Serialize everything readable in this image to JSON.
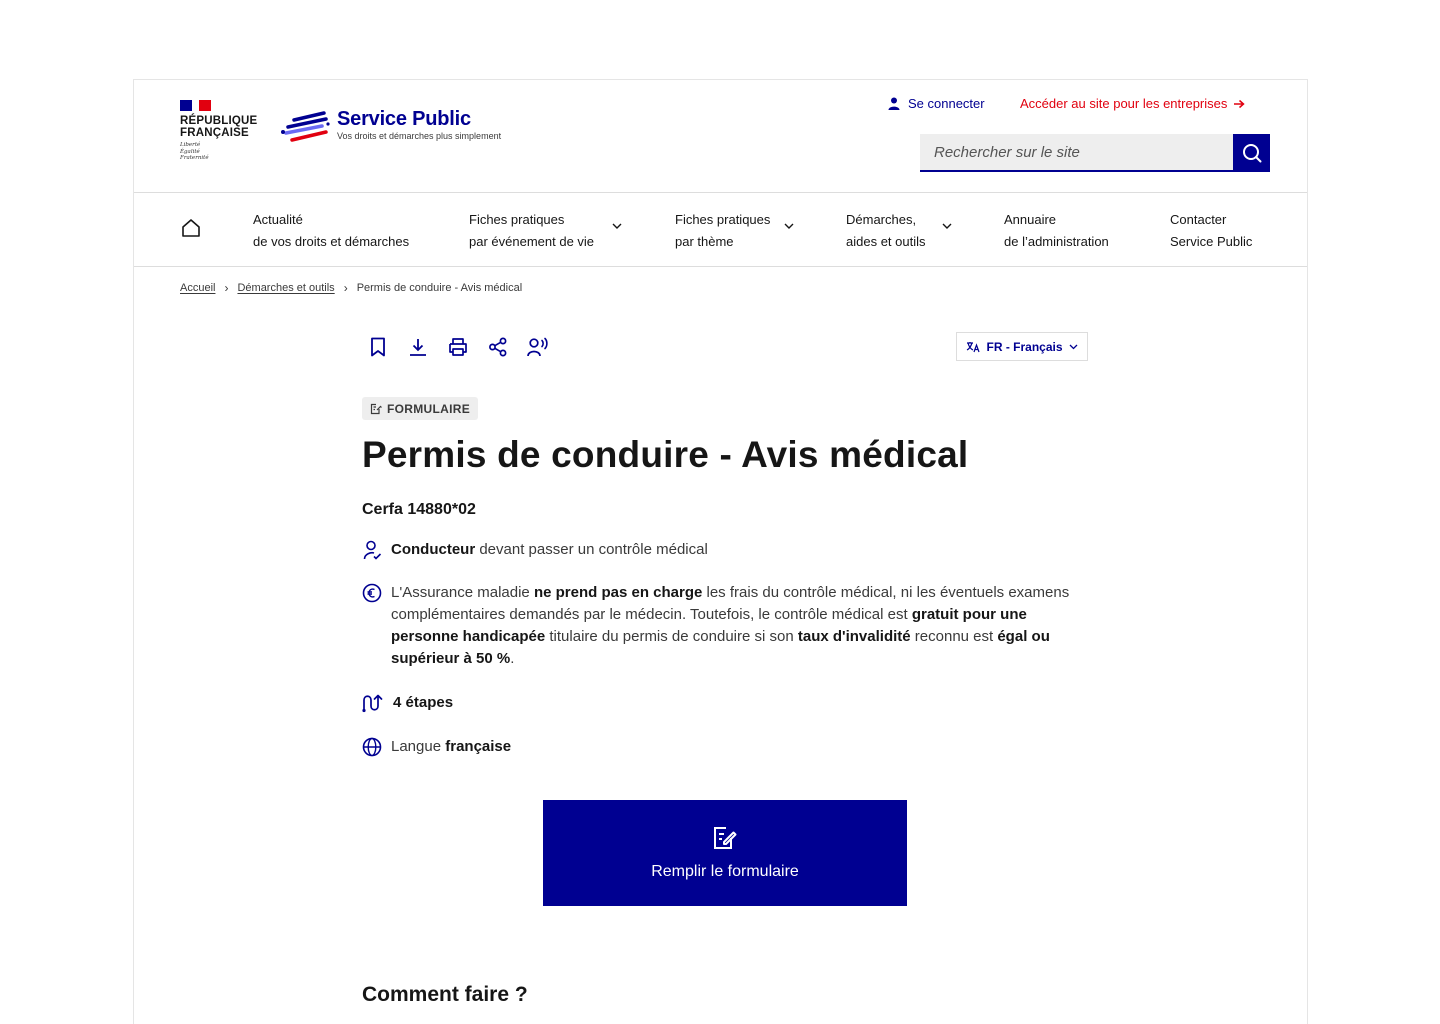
{
  "header": {
    "republique_line1": "RÉPUBLIQUE",
    "republique_line2": "FRANÇAISE",
    "devise": [
      "Liberté",
      "Égalité",
      "Fraternité"
    ],
    "site_title": "Service Public",
    "site_tagline": "Vos droits et démarches plus simplement",
    "login_label": "Se connecter",
    "business_link": "Accéder au site pour les entreprises",
    "search_placeholder": "Rechercher sur le site"
  },
  "nav": {
    "items": [
      {
        "line1": "Actualité",
        "line2": "de vos droits et démarches"
      },
      {
        "line1": "Fiches pratiques",
        "line2": "par événement de vie"
      },
      {
        "line1": "Fiches pratiques",
        "line2": "par thème"
      },
      {
        "line1": "Démarches,",
        "line2": "aides et outils"
      },
      {
        "line1": "Annuaire",
        "line2": "de l’administration"
      },
      {
        "line1": "Contacter",
        "line2": "Service Public"
      }
    ]
  },
  "breadcrumb": {
    "items": [
      "Accueil",
      "Démarches et outils",
      "Permis de conduire - Avis médical"
    ]
  },
  "language": {
    "label": "FR - Français"
  },
  "main": {
    "badge": "FORMULAIRE",
    "title": "Permis de conduire - Avis médical",
    "cerfa": "Cerfa 14880*02",
    "audience": {
      "bold": "Conducteur",
      "rest": " devant passer un contrôle médical"
    },
    "cost": {
      "p1": "L'Assurance maladie ",
      "b1": "ne prend pas en charge",
      "p2": " les frais du contrôle médical, ni les éventuels examens complémentaires demandés par le médecin. Toutefois, le contrôle médical est ",
      "b2": "gratuit pour une personne handicapée",
      "p3": " titulaire du permis de conduire si son ",
      "b3": "taux d'invalidité",
      "p4": " reconnu est ",
      "b4": "égal ou supérieur à 50 %",
      "p5": "."
    },
    "steps": "4 étapes",
    "language": {
      "prefix": "Langue ",
      "bold": "française"
    },
    "cta_label": "Remplir le formulaire",
    "section_title": "Comment faire ?"
  },
  "colors": {
    "primary": "#000091",
    "accent": "#e1000f"
  }
}
